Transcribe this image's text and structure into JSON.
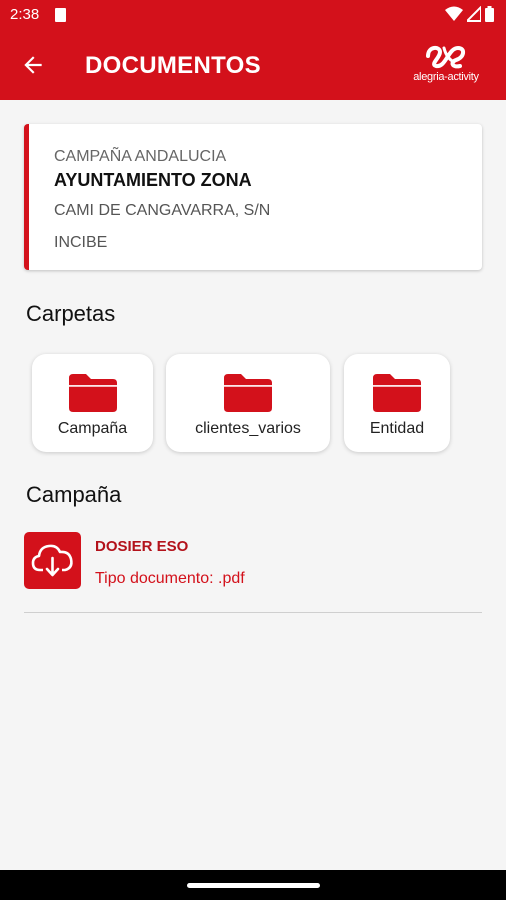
{
  "status_bar": {
    "time": "2:38"
  },
  "app_bar": {
    "title": "DOCUMENTOS",
    "logo_text": "alegria-activity"
  },
  "info_card": {
    "campaign": "CAMPAÑA ANDALUCIA",
    "name": "AYUNTAMIENTO ZONA",
    "address": "CAMI DE CANGAVARRA, S/N",
    "organization": "INCIBE"
  },
  "folders_section": {
    "title": "Carpetas",
    "items": [
      {
        "label": "Campaña"
      },
      {
        "label": "clientes_varios"
      },
      {
        "label": "Entidad"
      }
    ]
  },
  "documents_section": {
    "title": "Campaña",
    "items": [
      {
        "title": "DOSIER ESO",
        "type": "Tipo documento: .pdf"
      }
    ]
  },
  "colors": {
    "brand": "#d3111b",
    "background": "#f5f5f5"
  },
  "icons": [
    "arrow-back-icon",
    "cloud-download-icon",
    "folder-icon",
    "wifi-icon",
    "signal-icon",
    "battery-icon"
  ]
}
